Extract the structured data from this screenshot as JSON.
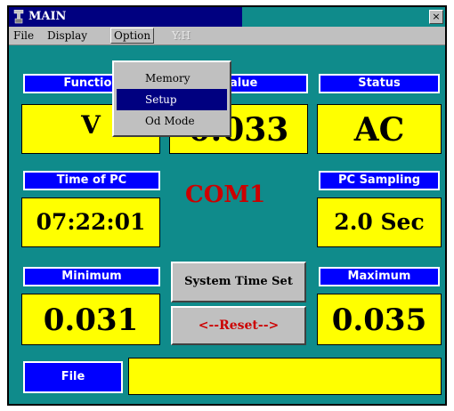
{
  "window": {
    "title": "MAIN",
    "close_glyph": "×"
  },
  "menu": {
    "file": "File",
    "display": "Display",
    "option": "Option",
    "disabled_item": "Y:H"
  },
  "option_menu": {
    "items": [
      "Memory",
      "Setup",
      "Od Mode"
    ],
    "selected": "Setup"
  },
  "panels": {
    "function": {
      "label": "Function",
      "value": "V"
    },
    "value": {
      "label": "Value",
      "value": "0.033"
    },
    "status": {
      "label": "Status",
      "value": "AC"
    },
    "time_of_pc": {
      "label": "Time of PC",
      "value": "07:22:01"
    },
    "pc_sampling": {
      "label": "PC Sampling",
      "value": "2.0 Sec"
    },
    "minimum": {
      "label": "Minimum",
      "value": "0.031"
    },
    "maximum": {
      "label": "Maximum",
      "value": "0.035"
    },
    "file": {
      "label": "File",
      "value": ""
    }
  },
  "com_port": "COM1",
  "buttons": {
    "system_time_set": "System Time Set",
    "reset": "<--Reset-->"
  },
  "colors": {
    "background": "#0f8b8b",
    "label_bg": "#0000ff",
    "value_bg": "#ffff00",
    "com_text": "#cc0000",
    "reset_text": "#cc0000",
    "titlebar_active": "#000080"
  }
}
